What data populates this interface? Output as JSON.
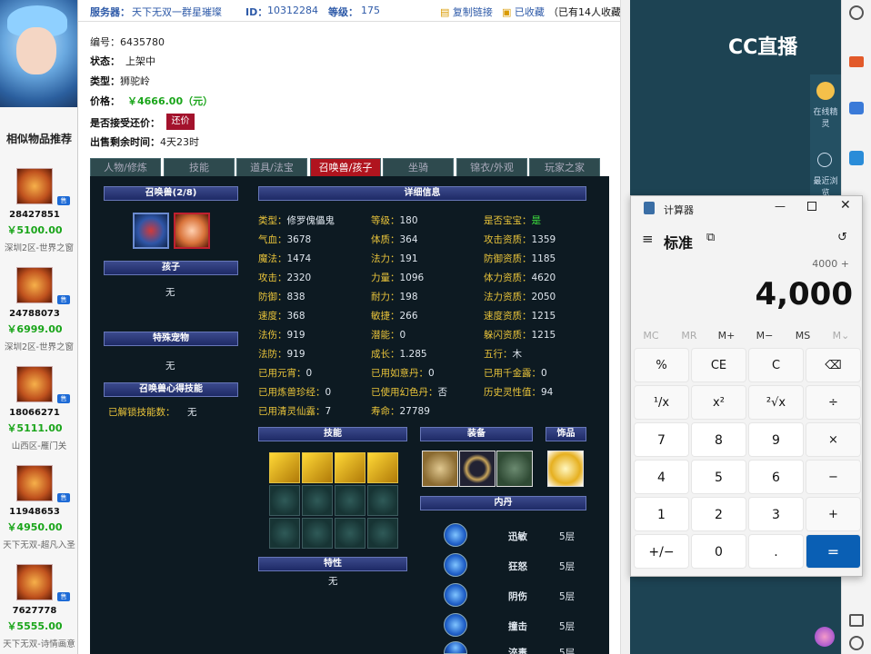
{
  "header": {
    "server_label": "服务器：",
    "server_value": "天下无双一群星璀璨",
    "id_label": "ID：",
    "id_value": "10312284",
    "level_label": "等级：",
    "level_value": "175",
    "copy_link": "复制链接",
    "favorited": "已收藏",
    "fav_count": "（已有14人收藏）"
  },
  "item": {
    "number": "编号：6435780",
    "status_label": "状态：",
    "status_value": "上架中",
    "type_label": "类型：",
    "type_value": "狮驼岭",
    "price_label": "价格：",
    "price_value": "￥4666.00（元）",
    "counter_label": "是否接受还价：",
    "counter_button": "还价",
    "remaining_label": "出售剩余时间：",
    "remaining_value": "4天23时"
  },
  "sidebar": {
    "title": "相似物品推荐",
    "items": [
      {
        "id": "28427851",
        "price": "￥5100.00",
        "server": "深圳2区-世界之窗",
        "tag": "售"
      },
      {
        "id": "24788073",
        "price": "￥6999.00",
        "server": "深圳2区-世界之窗",
        "tag": "售"
      },
      {
        "id": "18066271",
        "price": "￥5111.00",
        "server": "山西区-雁门关",
        "tag": "售"
      },
      {
        "id": "11948653",
        "price": "￥4950.00",
        "server": "天下无双-超凡入圣",
        "tag": "售"
      },
      {
        "id": "7627778",
        "price": "￥5555.00",
        "server": "天下无双-诗情画意",
        "tag": "售"
      }
    ]
  },
  "tabs": [
    "人物/修炼",
    "技能",
    "道具/法宝",
    "召唤兽/孩子",
    "坐骑",
    "锦衣/外观",
    "玩家之家"
  ],
  "pet_panel": {
    "summon_header": "召唤兽(2/8)",
    "child_header": "孩子",
    "child_value": "无",
    "special_header": "特殊宠物",
    "special_value": "无",
    "skill_header": "召唤兽心得技能",
    "unlocked_label": "已解锁技能数：",
    "unlocked_value": "无",
    "detail_header": "详细信息",
    "details": [
      [
        "类型：",
        "修罗傀儡鬼",
        "等级：",
        "180",
        "是否宝宝：",
        "是"
      ],
      [
        "气血：",
        "3678",
        "体质：",
        "364",
        "攻击资质：",
        "1359"
      ],
      [
        "魔法：",
        "1474",
        "法力：",
        "191",
        "防御资质：",
        "1185"
      ],
      [
        "攻击：",
        "2320",
        "力量：",
        "1096",
        "体力资质：",
        "4620"
      ],
      [
        "防御：",
        "838",
        "耐力：",
        "198",
        "法力资质：",
        "2050"
      ],
      [
        "速度：",
        "368",
        "敏捷：",
        "266",
        "速度资质：",
        "1215"
      ],
      [
        "法伤：",
        "919",
        "潜能：",
        "0",
        "躲闪资质：",
        "1215"
      ],
      [
        "法防：",
        "919",
        "成长：",
        "1.285",
        "五行：",
        "木"
      ],
      [
        "已用元宵：",
        "0",
        "已用如意丹：",
        "0",
        "已用千金露：",
        "0"
      ],
      [
        "已用炼兽珍经：",
        "0",
        "已使用幻色丹：",
        "否",
        "历史灵性值：",
        "94"
      ],
      [
        "已用清灵仙露：",
        "7",
        "寿命：",
        "27789",
        "",
        ""
      ]
    ],
    "skills_header": "技能",
    "equip_header": "装备",
    "accessory_header": "饰品",
    "neidan_header": "内丹",
    "trait_header": "特性",
    "trait_value": "无",
    "neidan": [
      {
        "name": "迅敏",
        "level": "5层"
      },
      {
        "name": "狂怒",
        "level": "5层"
      },
      {
        "name": "阴伤",
        "level": "5层"
      },
      {
        "name": "撞击",
        "level": "5层"
      },
      {
        "name": "淬毒",
        "level": "5层"
      }
    ]
  },
  "cc": {
    "logo": "CC直播",
    "online_label": "在线精灵",
    "recent_label": "最近浏览"
  },
  "calculator": {
    "title": "计算器",
    "mode": "标准",
    "expression": "4000 +",
    "display": "4,000",
    "memory": [
      "MC",
      "MR",
      "M+",
      "M−",
      "MS",
      "M⌄"
    ],
    "keys": [
      [
        "%",
        "CE",
        "C",
        "⌫"
      ],
      [
        "¹/x",
        "x²",
        "²√x",
        "÷"
      ],
      [
        "7",
        "8",
        "9",
        "×"
      ],
      [
        "4",
        "5",
        "6",
        "−"
      ],
      [
        "1",
        "2",
        "3",
        "+"
      ],
      [
        "+/−",
        "0",
        ".",
        "="
      ]
    ]
  }
}
